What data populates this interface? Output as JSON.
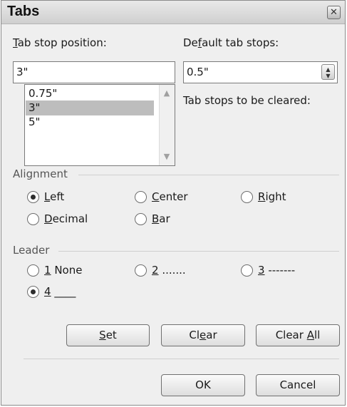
{
  "window": {
    "title": "Tabs",
    "close_glyph": "✕"
  },
  "tab_stop_position": {
    "label_key": "T",
    "label_rest": "ab stop position:",
    "value": "3\"",
    "list": [
      "0.75\"",
      "3\"",
      "5\""
    ],
    "selected_index": 1
  },
  "default_tab_stops": {
    "label_pre": "De",
    "label_key": "f",
    "label_rest": "ault tab stops:",
    "value": "0.5\""
  },
  "cleared_label": "Tab stops to be cleared:",
  "alignment": {
    "label": "Alignment",
    "options": [
      {
        "key": "L",
        "rest": "eft",
        "checked": true
      },
      {
        "key": "C",
        "rest": "enter",
        "checked": false
      },
      {
        "key": "R",
        "rest": "ight",
        "checked": false
      },
      {
        "key": "D",
        "rest": "ecimal",
        "checked": false
      },
      {
        "key": "B",
        "rest": "ar",
        "checked": false
      }
    ]
  },
  "leader": {
    "label": "Leader",
    "options": [
      {
        "key": "1",
        "rest": " None",
        "checked": false
      },
      {
        "key": "2",
        "rest": " .......",
        "checked": false
      },
      {
        "key": "3",
        "rest": " -------",
        "checked": false
      },
      {
        "key": "4",
        "rest": " ____",
        "checked": true
      }
    ]
  },
  "buttons": {
    "set": {
      "pre": "",
      "key": "S",
      "rest": "et"
    },
    "clear": {
      "pre": "Cl",
      "key": "e",
      "rest": "ar"
    },
    "clear_all": {
      "pre": "Clear ",
      "key": "A",
      "rest": "ll"
    },
    "ok": "OK",
    "cancel": "Cancel"
  },
  "icons": {
    "close": "close-icon",
    "spin_up": "spin-up-icon",
    "spin_down": "spin-down-icon",
    "scroll_up": "scroll-up-icon",
    "scroll_down": "scroll-down-icon"
  },
  "colors": {
    "dialog_bg": "#efefef",
    "selection": "#bdbdbd"
  }
}
